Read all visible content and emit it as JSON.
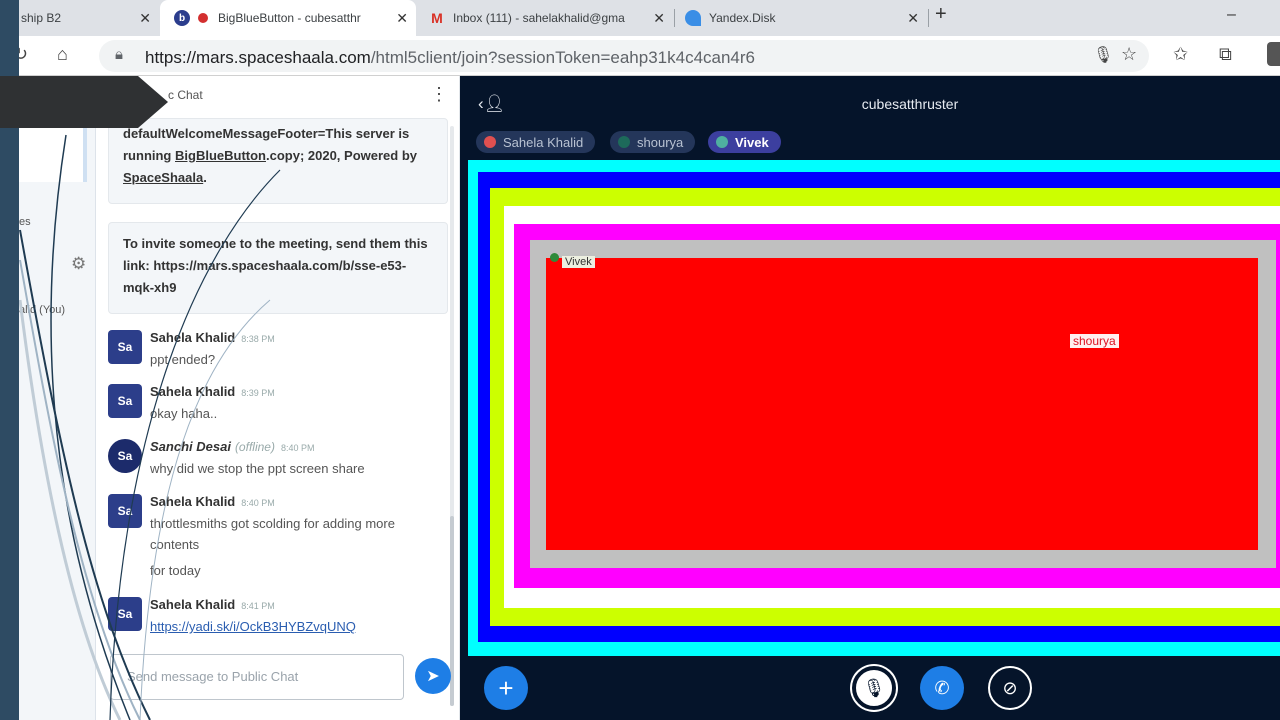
{
  "browser": {
    "tabs": [
      {
        "label": "ship B2"
      },
      {
        "label": "BigBlueButton - cubesatthr"
      },
      {
        "label": "Inbox (111) - sahelakhalid@gma"
      },
      {
        "label": "Yandex.Disk"
      }
    ],
    "new_tab": "+",
    "minimize": "–",
    "url_host": "https://mars.spaceshaala.com",
    "url_path": "/html5client/join?sessionToken=eahp31k4c4can4r6"
  },
  "users_panel": {
    "partial_label_1": "es",
    "partial_label_2": "alid (You)"
  },
  "chat": {
    "title": "c Chat",
    "system_messages": [
      {
        "bold_1": "defaultWelcomeMessageFooter=This server is running ",
        "link_text": "BigBlueButton",
        "bold_2": ".copy; 2020, Powered by ",
        "link_text_2": "SpaceShaala",
        "bold_3": "."
      },
      {
        "text": "To invite someone to the meeting, send them this link: https://mars.spaceshaala.com/b/sse-e53-mqk-xh9"
      }
    ],
    "messages": [
      {
        "initials": "Sa",
        "name": "Sahela Khalid",
        "time": "8:38 PM",
        "text": "ppt ended?"
      },
      {
        "initials": "Sa",
        "name": "Sahela Khalid",
        "time": "8:39 PM",
        "text": "okay haha.."
      },
      {
        "initials": "Sa",
        "name": "Sanchi Desai",
        "status": "(offline)",
        "time": "8:40 PM",
        "text": "why did we stop the ppt screen share"
      },
      {
        "initials": "Sa",
        "name": "Sahela Khalid",
        "time": "8:40 PM",
        "text": "throttlesmiths got scolding for adding more contents",
        "text2": "for today"
      },
      {
        "initials": "Sa",
        "name": "Sahela Khalid",
        "time": "8:41 PM",
        "text": "https://yadi.sk/i/OckB3HYBZvqUNQ"
      }
    ],
    "input_placeholder": "Send message to Public Chat"
  },
  "presentation": {
    "meeting_title": "cubesatthruster",
    "talkers": [
      {
        "name": "Sahela Khalid",
        "color": "#e05050"
      },
      {
        "name": "shourya",
        "color": "#1d6a5a"
      },
      {
        "name": "Vivek",
        "color": "#4fb0a0"
      }
    ],
    "cursor_labels": [
      "Vivek",
      "shourya"
    ],
    "colors": {
      "cyan": "#00ffff",
      "blue": "#0000ff",
      "yellow": "#ccff00",
      "white": "#ffffff",
      "magenta": "#ff00ff",
      "gray": "#c0c0c0",
      "red": "#ff0000"
    }
  }
}
